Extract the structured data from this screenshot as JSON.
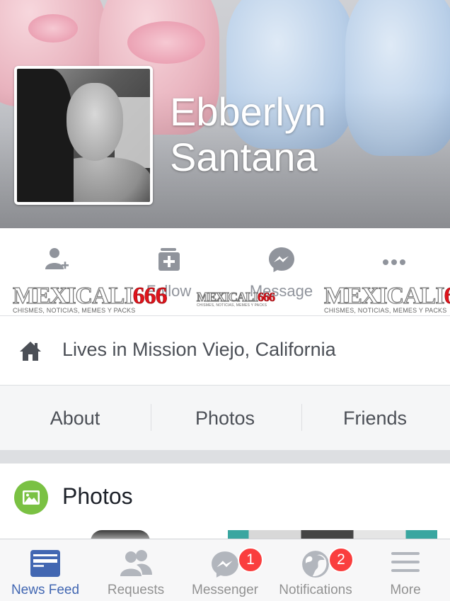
{
  "profile": {
    "name": "Ebberlyn Santana"
  },
  "actions": [
    {
      "label": "",
      "icon": "add-friend-icon"
    },
    {
      "label": "Follow",
      "icon": "follow-icon"
    },
    {
      "label": "Message",
      "icon": "messenger-icon"
    },
    {
      "label": "",
      "icon": "more-icon"
    }
  ],
  "watermark": {
    "part_a": "MEXICALI",
    "part_b": "666",
    "tagline": "CHISMES, NOTICIAS, MEMES Y PACKS"
  },
  "lives": {
    "text": "Lives in Mission Viejo, California",
    "icon": "home-icon"
  },
  "tabs": [
    {
      "label": "About"
    },
    {
      "label": "Photos"
    },
    {
      "label": "Friends"
    }
  ],
  "photos_section": {
    "title": "Photos",
    "icon": "photos-icon"
  },
  "tabbar": [
    {
      "label": "News Feed",
      "icon": "news-feed-icon",
      "active": true
    },
    {
      "label": "Requests",
      "icon": "friend-requests-icon"
    },
    {
      "label": "Messenger",
      "icon": "messenger-icon",
      "badge": "1"
    },
    {
      "label": "Notifications",
      "icon": "globe-icon",
      "badge": "2"
    },
    {
      "label": "More",
      "icon": "hamburger-menu-icon"
    }
  ],
  "colors": {
    "brand": "#4267b2",
    "icon_gray": "#90949c",
    "badge_red": "#fa3e3e",
    "photos_green": "#7ac143",
    "watermark_red": "#e0131b"
  }
}
